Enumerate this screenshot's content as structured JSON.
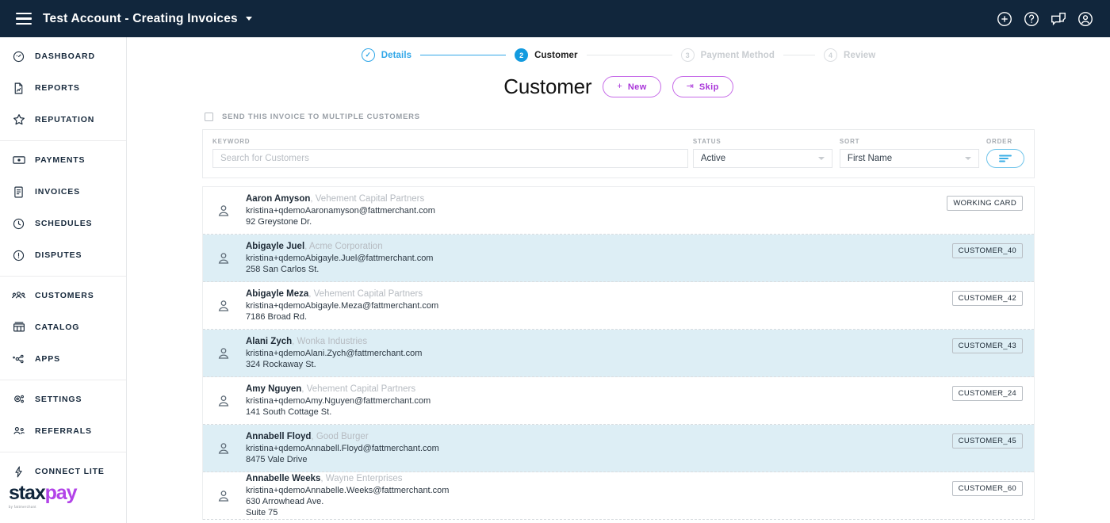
{
  "topbar": {
    "menu_icon": "hamburger-icon",
    "account_title": "Test Account - Creating Invoices",
    "dropdown_icon": "caret-down-icon",
    "actions": [
      {
        "name": "add-circle-icon"
      },
      {
        "name": "help-circle-icon"
      },
      {
        "name": "chat-icon"
      },
      {
        "name": "user-account-icon"
      }
    ]
  },
  "sidebar": {
    "groups": [
      {
        "items": [
          {
            "label": "DASHBOARD",
            "icon": "speedometer-icon"
          },
          {
            "label": "REPORTS",
            "icon": "document-chart-icon"
          },
          {
            "label": "REPUTATION",
            "icon": "star-icon"
          }
        ]
      },
      {
        "items": [
          {
            "label": "PAYMENTS",
            "icon": "cash-icon"
          },
          {
            "label": "INVOICES",
            "icon": "invoice-icon"
          },
          {
            "label": "SCHEDULES",
            "icon": "clock-icon"
          },
          {
            "label": "DISPUTES",
            "icon": "alert-circle-icon"
          }
        ]
      },
      {
        "items": [
          {
            "label": "CUSTOMERS",
            "icon": "people-icon"
          },
          {
            "label": "CATALOG",
            "icon": "catalog-icon"
          },
          {
            "label": "APPS",
            "icon": "apps-nodes-icon"
          }
        ]
      },
      {
        "items": [
          {
            "label": "SETTINGS",
            "icon": "gear-icon"
          },
          {
            "label": "REFERRALS",
            "icon": "referral-people-icon"
          }
        ]
      },
      {
        "items": [
          {
            "label": "CONNECT LITE",
            "icon": "lightning-icon"
          }
        ]
      }
    ],
    "logo": {
      "part1": "stax",
      "part2": "pay",
      "tagline": "by fattmerchant"
    }
  },
  "stepper": {
    "steps": [
      {
        "marker": "✓",
        "label": "Details",
        "state": "done"
      },
      {
        "marker": "2",
        "label": "Customer",
        "state": "active"
      },
      {
        "marker": "3",
        "label": "Payment Method",
        "state": "todo"
      },
      {
        "marker": "4",
        "label": "Review",
        "state": "todo"
      }
    ]
  },
  "page": {
    "title": "Customer",
    "new_button": {
      "glyph": "+",
      "label": "New"
    },
    "skip_button": {
      "glyph": "⇥",
      "label": "Skip"
    },
    "multi_customer_checkbox": {
      "label": "SEND THIS INVOICE TO MULTIPLE CUSTOMERS",
      "checked": false
    }
  },
  "filters": {
    "keyword": {
      "label": "KEYWORD",
      "value": "",
      "placeholder": "Search for Customers"
    },
    "status": {
      "label": "STATUS",
      "value": "Active"
    },
    "sort": {
      "label": "SORT",
      "value": "First Name"
    },
    "order": {
      "label": "ORDER",
      "icon": "sort-descending-icon"
    }
  },
  "customers": [
    {
      "name": "Aaron Amyson",
      "company": "Vehement Capital Partners",
      "email": "kristina+qdemoAaronamyson@fattmerchant.com",
      "address1": "92 Greystone Dr.",
      "address2": "",
      "badge": "WORKING CARD"
    },
    {
      "name": "Abigayle Juel",
      "company": "Acme Corporation",
      "email": "kristina+qdemoAbigayle.Juel@fattmerchant.com",
      "address1": "258 San Carlos St.",
      "address2": "",
      "badge": "CUSTOMER_40"
    },
    {
      "name": "Abigayle Meza",
      "company": "Vehement Capital Partners",
      "email": "kristina+qdemoAbigayle.Meza@fattmerchant.com",
      "address1": "7186 Broad Rd.",
      "address2": "",
      "badge": "CUSTOMER_42"
    },
    {
      "name": "Alani Zych",
      "company": "Wonka Industries",
      "email": "kristina+qdemoAlani.Zych@fattmerchant.com",
      "address1": "324 Rockaway St.",
      "address2": "",
      "badge": "CUSTOMER_43"
    },
    {
      "name": "Amy Nguyen",
      "company": "Vehement Capital Partners",
      "email": "kristina+qdemoAmy.Nguyen@fattmerchant.com",
      "address1": "141 South Cottage St.",
      "address2": "",
      "badge": "CUSTOMER_24"
    },
    {
      "name": "Annabell Floyd",
      "company": "Good Burger",
      "email": "kristina+qdemoAnnabell.Floyd@fattmerchant.com",
      "address1": "8475 Vale Drive",
      "address2": "",
      "badge": "CUSTOMER_45"
    },
    {
      "name": "Annabelle Weeks",
      "company": "Wayne Enterprises",
      "email": "kristina+qdemoAnnabelle.Weeks@fattmerchant.com",
      "address1": "630 Arrowhead Ave.",
      "address2": "Suite 75",
      "badge": "CUSTOMER_60"
    }
  ],
  "colors": {
    "topbar_bg": "#11263c",
    "accent_blue": "#139bdf",
    "accent_purple": "#a935d9",
    "row_alt_bg": "#ddeef5"
  }
}
